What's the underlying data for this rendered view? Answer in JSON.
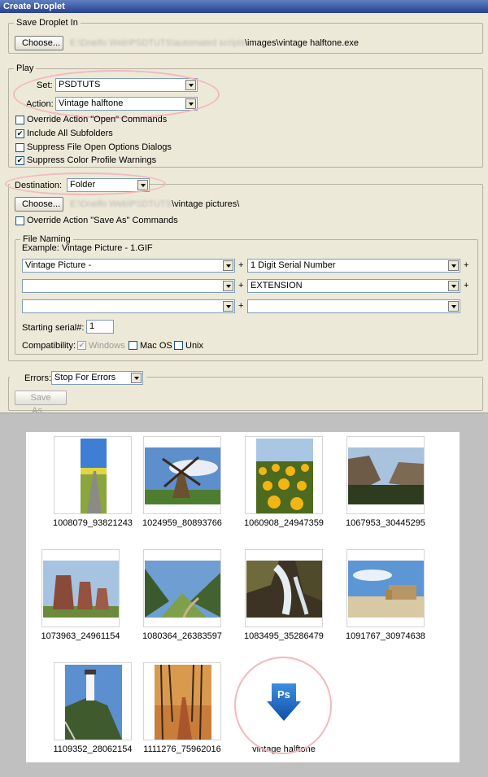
{
  "dialog": {
    "title": "Create Droplet",
    "save_in": {
      "legend": "Save Droplet In",
      "choose_label": "Choose...",
      "path_blurred": "E:\\Dnelfo Web\\PSDTUTS\\automated scripts",
      "path_visible": "\\images\\vintage halftone.exe"
    },
    "play": {
      "legend": "Play",
      "set_label": "Set:",
      "set_value": "PSDTUTS",
      "action_label": "Action:",
      "action_value": "Vintage halftone",
      "checkboxes": [
        {
          "label": "Override Action \"Open\" Commands",
          "checked": false
        },
        {
          "label": "Include All Subfolders",
          "checked": true
        },
        {
          "label": "Suppress File Open Options Dialogs",
          "checked": false
        },
        {
          "label": "Suppress Color Profile Warnings",
          "checked": true
        }
      ]
    },
    "destination": {
      "label": "Destination:",
      "value": "Folder",
      "choose_label": "Choose...",
      "path_blurred": "E:\\Dnelfo Web\\PSDTUTS",
      "path_visible": "\\vintage pictures\\",
      "override_label": "Override Action \"Save As\" Commands",
      "override_checked": false
    },
    "file_naming": {
      "legend": "File Naming",
      "example": "Example: Vintage Picture - 1.GIF",
      "fields": [
        [
          "Vintage Picture -",
          "1 Digit Serial Number"
        ],
        [
          "",
          "EXTENSION"
        ],
        [
          "",
          ""
        ]
      ],
      "plus": "+",
      "starting_serial_label": "Starting serial#:",
      "starting_serial_value": "1",
      "compatibility_label": "Compatibility:",
      "compat": [
        {
          "label": "Windows",
          "checked": true,
          "disabled": true
        },
        {
          "label": "Mac OS",
          "checked": false,
          "disabled": false
        },
        {
          "label": "Unix",
          "checked": false,
          "disabled": false
        }
      ]
    },
    "errors": {
      "label": "Errors:",
      "value": "Stop For Errors",
      "save_as_label": "Save As..."
    }
  },
  "gallery": {
    "items": [
      {
        "name": "1008079_93821243",
        "kind": "road"
      },
      {
        "name": "1024959_80893766",
        "kind": "windmill"
      },
      {
        "name": "1060908_24947359",
        "kind": "sunflowers"
      },
      {
        "name": "1067953_30445295",
        "kind": "canyon"
      },
      {
        "name": "1073963_24961154",
        "kind": "towers"
      },
      {
        "name": "1080364_26383597",
        "kind": "valley"
      },
      {
        "name": "1083495_35286479",
        "kind": "waterfall"
      },
      {
        "name": "1091767_30974638",
        "kind": "desert"
      },
      {
        "name": "1109352_28062154",
        "kind": "lighthouse"
      },
      {
        "name": "1111276_75962016",
        "kind": "autumn"
      },
      {
        "name": "vintage halftone",
        "kind": "droplet-icon",
        "icon_text": "Ps"
      }
    ]
  }
}
